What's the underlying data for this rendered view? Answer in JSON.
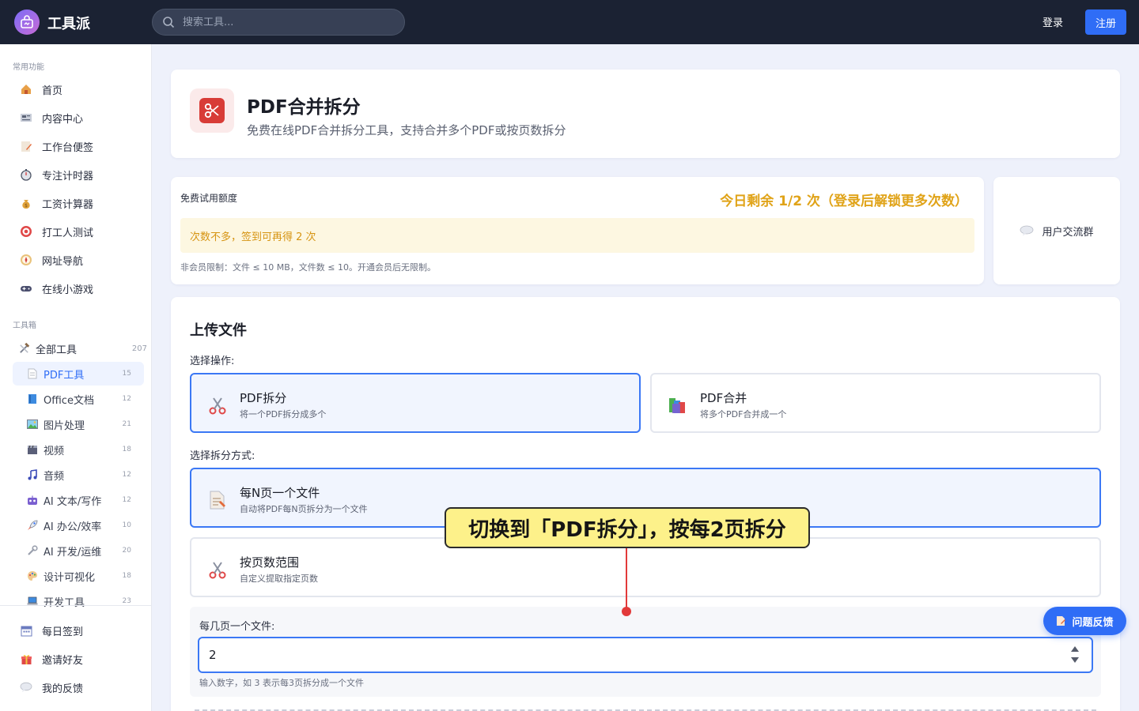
{
  "header": {
    "brand": "工具派",
    "search_placeholder": "搜索工具...",
    "login": "登录",
    "register": "注册"
  },
  "sidebar": {
    "common_title": "常用功能",
    "common_items": [
      {
        "label": "首页",
        "icon": "home-icon"
      },
      {
        "label": "内容中心",
        "icon": "newspaper-icon"
      },
      {
        "label": "工作台便签",
        "icon": "memo-icon"
      },
      {
        "label": "专注计时器",
        "icon": "stopwatch-icon"
      },
      {
        "label": "工资计算器",
        "icon": "money-bag-icon"
      },
      {
        "label": "打工人测试",
        "icon": "target-icon"
      },
      {
        "label": "网址导航",
        "icon": "compass-icon"
      },
      {
        "label": "在线小游戏",
        "icon": "gamepad-icon"
      }
    ],
    "toolbox_title": "工具箱",
    "all_tools": {
      "label": "全部工具",
      "count": "207"
    },
    "categories": [
      {
        "label": "PDF工具",
        "count": "15",
        "icon": "document-icon",
        "active": true
      },
      {
        "label": "Office文档",
        "count": "12",
        "icon": "book-icon"
      },
      {
        "label": "图片处理",
        "count": "21",
        "icon": "picture-icon"
      },
      {
        "label": "视频",
        "count": "18",
        "icon": "clapper-icon"
      },
      {
        "label": "音频",
        "count": "12",
        "icon": "music-note-icon"
      },
      {
        "label": "AI 文本/写作",
        "count": "12",
        "icon": "robot-icon"
      },
      {
        "label": "AI 办公/效率",
        "count": "10",
        "icon": "rocket-icon"
      },
      {
        "label": "AI 开发/运维",
        "count": "20",
        "icon": "wrench-icon"
      },
      {
        "label": "设计可视化",
        "count": "18",
        "icon": "palette-icon"
      },
      {
        "label": "开发工具",
        "count": "23",
        "icon": "laptop-icon"
      }
    ],
    "bottom_items": [
      {
        "label": "每日签到",
        "icon": "calendar-icon"
      },
      {
        "label": "邀请好友",
        "icon": "gift-icon"
      },
      {
        "label": "我的反馈",
        "icon": "speech-bubble-icon"
      }
    ]
  },
  "tool": {
    "title": "PDF合并拆分",
    "subtitle": "免费在线PDF合并拆分工具，支持合并多个PDF或按页数拆分"
  },
  "quota": {
    "label": "免费试用额度",
    "remaining": "今日剩余 1/2 次（登录后解锁更多次数）",
    "tip": "次数不多，签到可再得 2 次",
    "limit": "非会员限制：文件 ≤ 10 MB，文件数 ≤ 10。开通会员后无限制。"
  },
  "group": {
    "label": "用户交流群"
  },
  "upload": {
    "title": "上传文件",
    "operation_label": "选择操作:",
    "operations": [
      {
        "title": "PDF拆分",
        "desc": "将一个PDF拆分成多个",
        "selected": true
      },
      {
        "title": "PDF合并",
        "desc": "将多个PDF合并成一个",
        "selected": false
      }
    ],
    "method_label": "选择拆分方式:",
    "methods": [
      {
        "title": "每N页一个文件",
        "desc": "自动将PDF每N页拆分为一个文件",
        "selected": true
      },
      {
        "title": "按页数范围",
        "desc": "自定义提取指定页数",
        "selected": false
      }
    ],
    "n_label": "每几页一个文件:",
    "n_value": "2",
    "n_hint": "输入数字，如 3 表示每3页拆分成一个文件"
  },
  "feedback_button": "问题反馈",
  "annotation": "切换到「PDF拆分」，按每2页拆分",
  "colors": {
    "topbar": "#1b2233",
    "accent": "#2f6df6",
    "quota_highlight": "#e0a318",
    "callout_bg": "#fdf18a",
    "callout_line": "#e23a3a"
  }
}
